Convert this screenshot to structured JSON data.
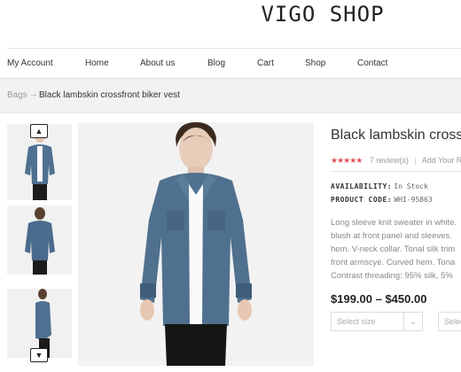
{
  "site": {
    "logo": "VIGO SHOP"
  },
  "nav": [
    {
      "label": "My Account"
    },
    {
      "label": "Home"
    },
    {
      "label": "About us"
    },
    {
      "label": "Blog"
    },
    {
      "label": "Cart"
    },
    {
      "label": "Shop"
    },
    {
      "label": "Contact"
    }
  ],
  "breadcrumb": {
    "parent": "Bags",
    "separator": "→",
    "current": "Black lambskin crossfront biker vest"
  },
  "product": {
    "title": "Black lambskin crossfr",
    "rating": {
      "stars": "★★★★★",
      "value": 4.5,
      "reviews": "7 review(s)",
      "add_review": "Add Your R"
    },
    "availability_label": "AVAILABILITY:",
    "availability_value": "In Stock",
    "code_label": "PRODUCT CODE:",
    "code_value": "WHI-95863",
    "description_lines": [
      "Long sleeve knit sweater in white.",
      "blush at front panel and sleeves.",
      "hem. V-neck collar. Tonal silk trim",
      "front armscye. Curved hem. Tona",
      "Contrast threading: 95% silk, 5%"
    ],
    "price": "$199.00 – $450.00",
    "size_select": {
      "placeholder": "Select size"
    },
    "second_select": {
      "placeholder": "Selec"
    }
  },
  "gallery": {
    "up_arrow": "▲",
    "down_arrow": "▼"
  },
  "colors": {
    "star": "#e0525a",
    "denim": "#4f7090",
    "background": "#f2f2f2"
  }
}
